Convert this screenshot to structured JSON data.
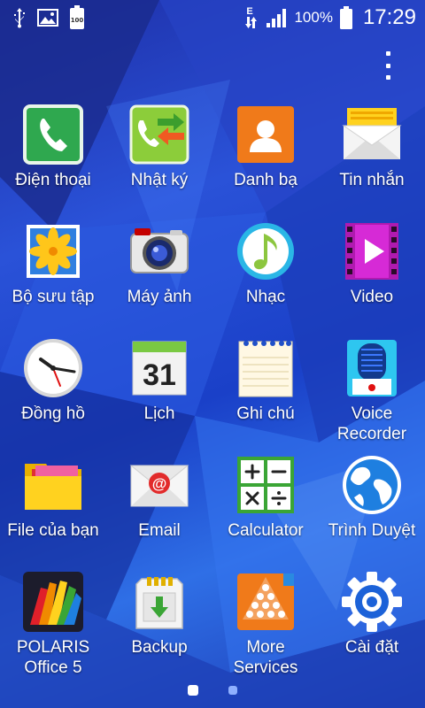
{
  "status_bar": {
    "left_icons": [
      "usb-icon",
      "gallery-notification-icon",
      "battery-full-notification-icon"
    ],
    "battery_note_text": "100",
    "network_type": "E",
    "battery_percent": "100%",
    "time": "17:29"
  },
  "apps": [
    {
      "label": "Điện thoại",
      "icon": "phone-icon"
    },
    {
      "label": "Nhật ký",
      "icon": "call-log-icon"
    },
    {
      "label": "Danh bạ",
      "icon": "contacts-icon"
    },
    {
      "label": "Tin nhắn",
      "icon": "messages-icon"
    },
    {
      "label": "Bộ sưu tập",
      "icon": "gallery-icon"
    },
    {
      "label": "Máy ảnh",
      "icon": "camera-icon"
    },
    {
      "label": "Nhạc",
      "icon": "music-icon"
    },
    {
      "label": "Video",
      "icon": "video-icon"
    },
    {
      "label": "Đồng hồ",
      "icon": "clock-icon"
    },
    {
      "label": "Lịch",
      "icon": "calendar-icon",
      "badge": "31"
    },
    {
      "label": "Ghi chú",
      "icon": "notes-icon"
    },
    {
      "label": "Voice\nRecorder",
      "icon": "voice-recorder-icon"
    },
    {
      "label": "File của bạn",
      "icon": "folder-icon"
    },
    {
      "label": "Email",
      "icon": "email-icon"
    },
    {
      "label": "Calculator",
      "icon": "calculator-icon"
    },
    {
      "label": "Trình Duyệt",
      "icon": "browser-globe-icon"
    },
    {
      "label": "POLARIS\nOffice 5",
      "icon": "polaris-office-icon"
    },
    {
      "label": "Backup",
      "icon": "backup-icon"
    },
    {
      "label": "More\nServices",
      "icon": "more-services-icon"
    },
    {
      "label": "Cài đặt",
      "icon": "settings-gear-icon"
    }
  ],
  "pager": {
    "total_pages": 2,
    "current_page": 1
  },
  "colors": {
    "wallpaper": "#2a52d8",
    "pager_active": "#ffffff",
    "pager_inactive": "#8fb0ff"
  }
}
